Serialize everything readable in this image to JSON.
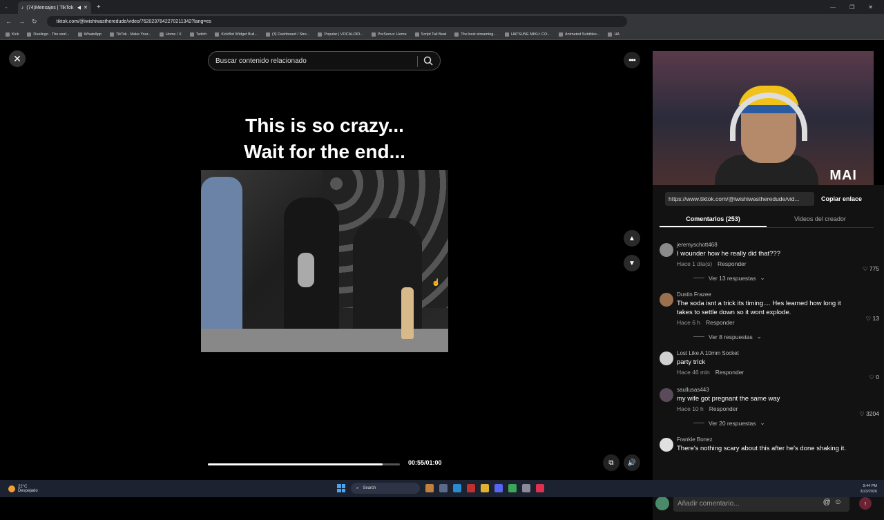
{
  "browser": {
    "tab_title": "(74)Mensajes | TikTok",
    "url": "tiktok.com/@iwishiwastheredude/video/7620237842270211342?lang=es",
    "bookmarks": [
      "Kick",
      "Duolingo - The worl...",
      "WhatsApp",
      "TikTok - Make Your...",
      "Home / X",
      "Twitch",
      "KickBot Widget Buil...",
      "(3) Dashboard / Stre...",
      "Popular | VOCALOID...",
      "PreSonus: Home",
      "Script Tail Beat",
      "The best streaming...",
      "HATSUNE MIKU: CO...",
      "Animated Subtitles...",
      "HA"
    ]
  },
  "video": {
    "search_placeholder": "Buscar contenido relacionado",
    "caption_line1": "This is so crazy...",
    "caption_line2": "Wait for the end...",
    "time": "00:55/01:00",
    "progress": 0.91
  },
  "webcam": {
    "logo": "MAI"
  },
  "panel": {
    "link": "https://www.tiktok.com/@iwishiwastheredude/vid...",
    "copy_label": "Copiar enlace",
    "tab_comments": "Comentarios (253)",
    "tab_creator": "Videos del creador",
    "comments": [
      {
        "user": "jeremyschott468",
        "text": "I wounder how he really did that???",
        "time": "Hace 1 día(s)",
        "reply": "Responder",
        "likes": "775",
        "replies": "Ver 13 respuestas"
      },
      {
        "user": "Dustin Frazee",
        "text": "The soda isnt a trick its timing.... Hes learned how long it takes to settle down so it wont explode.",
        "time": "Hace 6 h",
        "reply": "Responder",
        "likes": "13",
        "replies": "Ver 8 respuestas"
      },
      {
        "user": "Lost Like A 10mm Socket",
        "text": "party trick",
        "time": "Hace 46 min",
        "reply": "Responder",
        "likes": "0",
        "replies": ""
      },
      {
        "user": "saullusas443",
        "text": "my wife got pregnant the same way",
        "time": "Hace 10 h",
        "reply": "Responder",
        "likes": "3204",
        "replies": "Ver 20 respuestas"
      },
      {
        "user": "Frankie Bonez",
        "text": "There's nothing scary about this after he's done shaking it.",
        "time": "",
        "reply": "",
        "likes": "",
        "replies": ""
      }
    ],
    "composer_placeholder": "Añadir comentario..."
  },
  "taskbar": {
    "temp": "22°C",
    "weather": "Despejado",
    "search": "Search",
    "time": "9:44 PM",
    "date": "3/23/2026"
  }
}
